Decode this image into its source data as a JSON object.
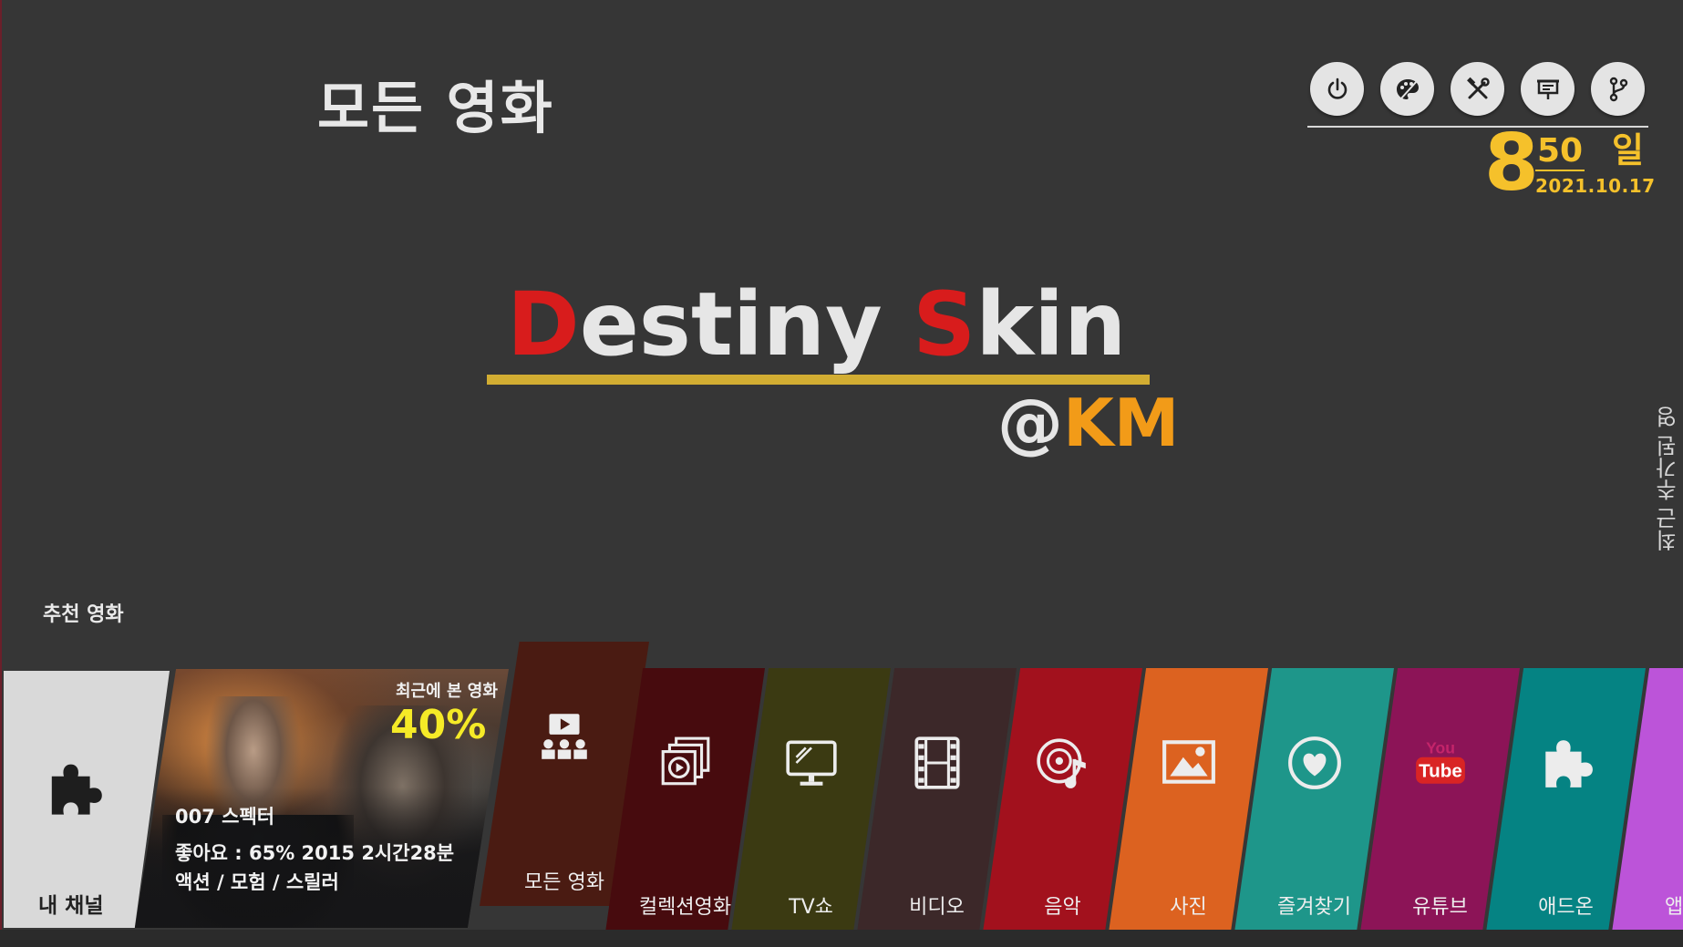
{
  "header": {
    "title": "모든 영화"
  },
  "top_buttons": [
    {
      "name": "power-button",
      "icon": "power-icon"
    },
    {
      "name": "theme-button",
      "icon": "palette-icon"
    },
    {
      "name": "tools-button",
      "icon": "tools-icon"
    },
    {
      "name": "presentation-button",
      "icon": "presentation-icon"
    },
    {
      "name": "branch-button",
      "icon": "branch-icon"
    }
  ],
  "clock": {
    "hour": "8",
    "minute": "50",
    "day": "일",
    "date": "2021.10.17"
  },
  "logo": {
    "d": "D",
    "estiny": "estiny",
    "s": "S",
    "kin": "kin",
    "at": "@",
    "km": "KM"
  },
  "side_label": "최근 추가된 영화",
  "recommend_label": "추천 영화",
  "my_channel": {
    "label": "내 채널",
    "icon": "puzzle-icon"
  },
  "recent_movie": {
    "caption": "최근에 본 영화",
    "percent": "40%",
    "title": "007 스펙터",
    "info": "좋아요 : 65% 2015 2시간28분",
    "genre": "액션 / 모험 / 스릴러"
  },
  "tiles": [
    {
      "label": "모든 영화",
      "icon": "cinema-icon",
      "color": "#4a1b12",
      "focused": true
    },
    {
      "label": "컬렉션영화",
      "icon": "collection-icon",
      "color": "#470b0e"
    },
    {
      "label": "TV쇼",
      "icon": "tv-icon",
      "color": "#3b3a12"
    },
    {
      "label": "비디오",
      "icon": "film-icon",
      "color": "#3c2829"
    },
    {
      "label": "음악",
      "icon": "music-icon",
      "color": "#a2111d"
    },
    {
      "label": "사진",
      "icon": "photo-icon",
      "color": "#dc6220"
    },
    {
      "label": "즐겨찾기",
      "icon": "heart-icon",
      "color": "#1e968a"
    },
    {
      "label": "유튜브",
      "icon": "youtube-icon",
      "color": "#8c1457"
    },
    {
      "label": "애드온",
      "icon": "addon-icon",
      "color": "#058383"
    },
    {
      "label": "앱",
      "icon": "app-icon",
      "color": "#bc54d9"
    }
  ]
}
